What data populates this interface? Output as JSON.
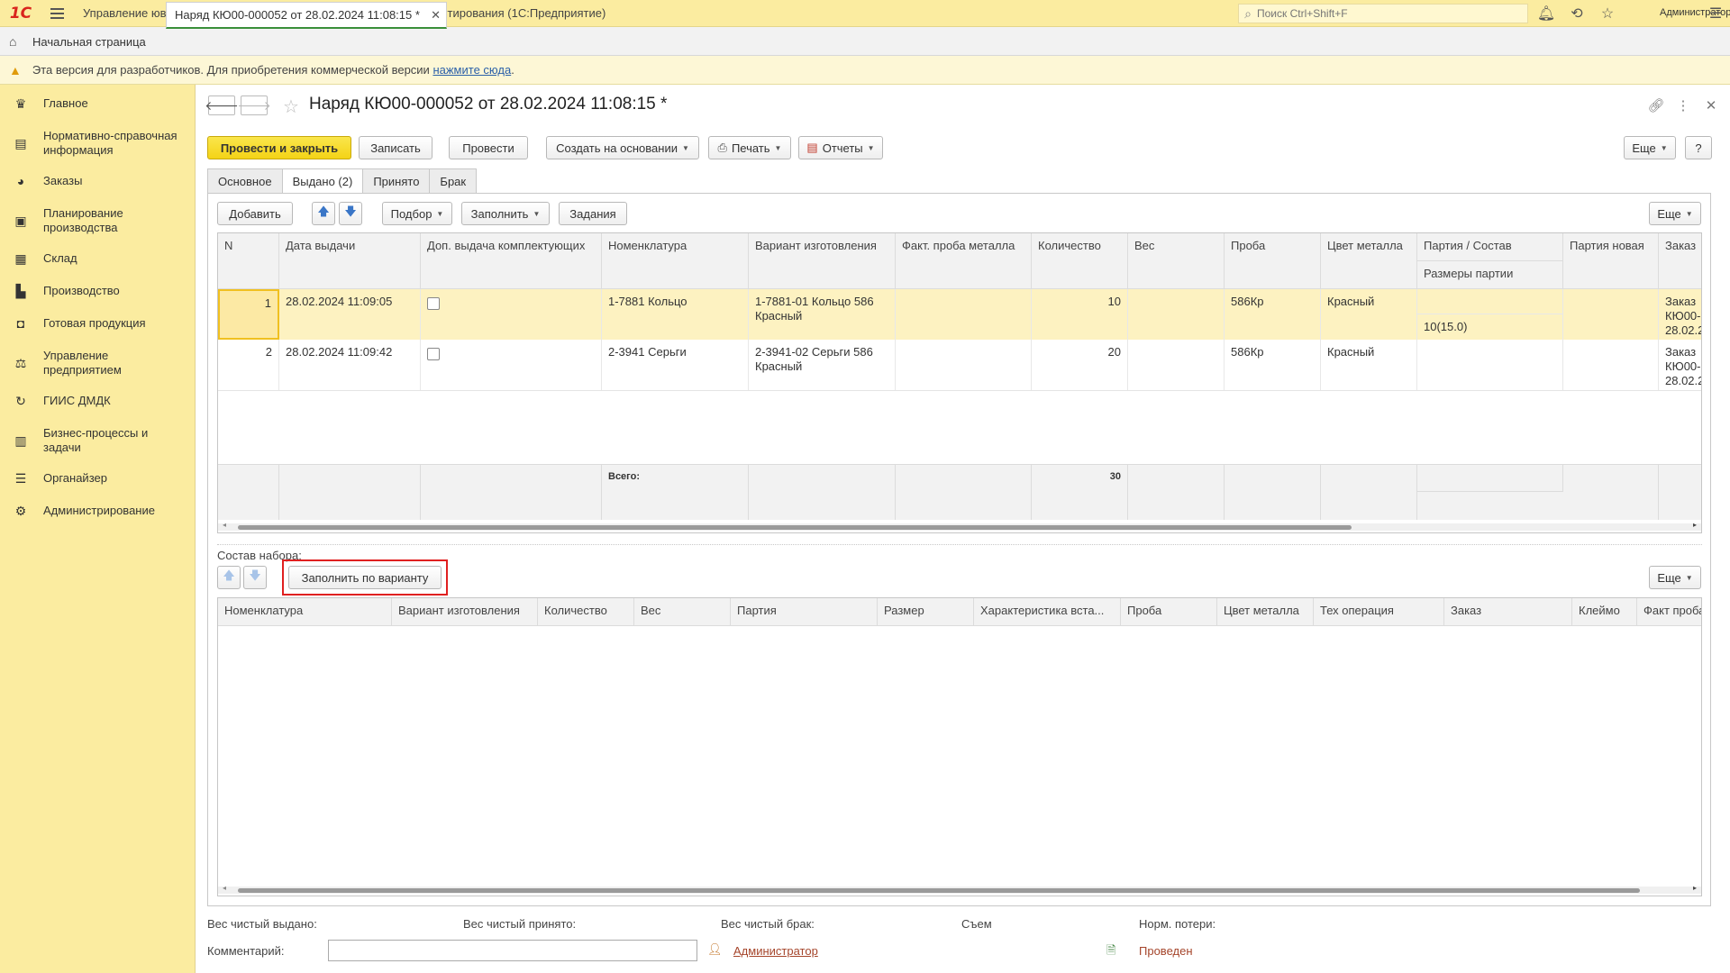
{
  "app": {
    "logo": "1С",
    "title": "Управление ювелирным производством, редакция 5.2  - Клиент тестирования (1С:Предприятие)",
    "search_placeholder": "Поиск Ctrl+Shift+F",
    "user": "Администратор"
  },
  "tabs": {
    "home": "Начальная страница",
    "document": "Наряд КЮ00-000052 от 28.02.2024 11:08:15 *"
  },
  "infobar": {
    "text": "Эта версия для разработчиков. Для приобретения коммерческой версии ",
    "link": "нажмите сюда",
    "suffix": "."
  },
  "sidebar": {
    "items": [
      {
        "label": "Главное",
        "icon": "crown-icon"
      },
      {
        "label": "Нормативно-справочная информация",
        "icon": "books-icon"
      },
      {
        "label": "Заказы",
        "icon": "pie-chart-icon"
      },
      {
        "label": "Планирование производства",
        "icon": "clipboard-icon"
      },
      {
        "label": "Склад",
        "icon": "grid-icon"
      },
      {
        "label": "Производство",
        "icon": "factory-icon"
      },
      {
        "label": "Готовая продукция",
        "icon": "bag-icon"
      },
      {
        "label": "Управление предприятием",
        "icon": "org-icon"
      },
      {
        "label": "ГИИС ДМДК",
        "icon": "refresh-icon"
      },
      {
        "label": "Бизнес-процессы и задачи",
        "icon": "building-icon"
      },
      {
        "label": "Органайзер",
        "icon": "sliders-icon"
      },
      {
        "label": "Администрирование",
        "icon": "gear-icon"
      }
    ]
  },
  "form": {
    "title": "Наряд КЮ00-000052 от 28.02.2024 11:08:15 *",
    "toolbar": {
      "post_close": "Провести и закрыть",
      "save": "Записать",
      "post": "Провести",
      "create_based": "Создать на основании",
      "print": "Печать",
      "reports": "Отчеты",
      "more": "Еще",
      "help": "?"
    },
    "tabs": [
      "Основное",
      "Выдано (2)",
      "Принято",
      "Брак"
    ]
  },
  "issued": {
    "toolbar": {
      "add": "Добавить",
      "pick": "Подбор",
      "fill": "Заполнить",
      "tasks": "Задания",
      "more": "Еще"
    },
    "columns": {
      "n": "N",
      "date": "Дата выдачи",
      "extra": "Доп. выдача комплектующих",
      "nomenclature": "Номенклатура",
      "variant": "Вариант изготовления",
      "fact_probe": "Факт. проба металла",
      "qty": "Количество",
      "weight": "Вес",
      "probe": "Проба",
      "color": "Цвет металла",
      "batch": "Партия / Состав",
      "batch_sizes": "Размеры партии",
      "batch_new": "Партия новая",
      "order": "Заказ"
    },
    "rows": [
      {
        "n": "1",
        "date": "28.02.2024 11:09:05",
        "nomenclature": "1-7881 Кольцо",
        "variant": "1-7881-01 Кольцо 586 Красный",
        "qty": "10",
        "probe": "586Кр",
        "color": "Красный",
        "batch_sizes": "10(15.0)",
        "order": "Заказ КЮ00- 28.02.2"
      },
      {
        "n": "2",
        "date": "28.02.2024 11:09:42",
        "nomenclature": "2-3941 Серьги",
        "variant": "2-3941-02 Серьги 586 Красный",
        "qty": "20",
        "probe": "586Кр",
        "color": "Красный",
        "batch_sizes": "",
        "order": "Заказ КЮ00- 28.02.2"
      }
    ],
    "footer": {
      "total_label": "Всего:",
      "total_qty": "30"
    }
  },
  "kit": {
    "label": "Состав набора:",
    "fill_by_variant": "Заполнить по варианту",
    "more": "Еще",
    "columns": [
      "Номенклатура",
      "Вариант изготовления",
      "Количество",
      "Вес",
      "Партия",
      "Размер",
      "Характеристика вста...",
      "Проба",
      "Цвет металла",
      "Тех операция",
      "Заказ",
      "Клеймо",
      "Факт проба"
    ]
  },
  "bottom": {
    "net_issued": "Вес чистый выдано:",
    "net_received": "Вес чистый принято:",
    "net_defect": "Вес чистый брак:",
    "removal": "Съем",
    "norm_loss": "Норм. потери:",
    "comment": "Комментарий:",
    "author": "Администратор",
    "status": "Проведен"
  },
  "colors": {
    "accent_yellow": "#fbeca0",
    "primary_button": "#f4d316",
    "highlight_row": "#fdf2c1",
    "link": "#a5452b",
    "red_frame": "#e02020"
  }
}
